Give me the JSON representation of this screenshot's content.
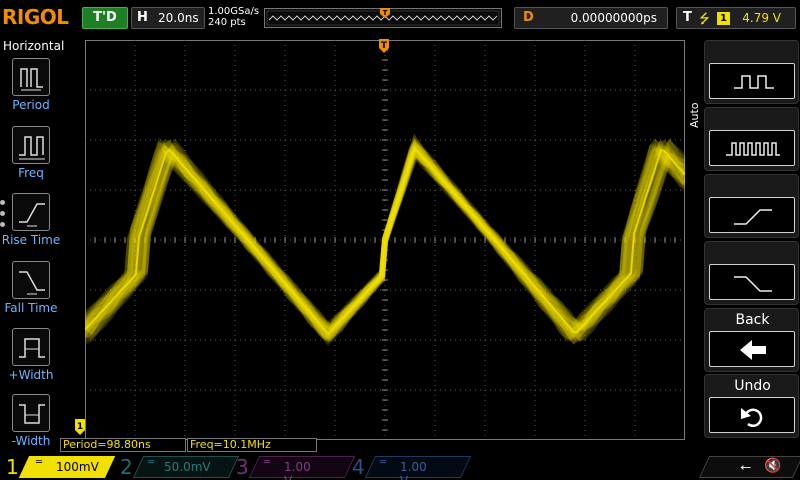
{
  "brand": "RIGOL",
  "run_state": "T'D",
  "horizontal": {
    "key": "H",
    "timebase": "20.0ns"
  },
  "acquisition": {
    "sample_rate": "1.00GSa/s",
    "points": "240 pts"
  },
  "memory_trigger_marker": "T",
  "delay": {
    "key": "D",
    "value": "0.00000000ps"
  },
  "trigger": {
    "key": "T",
    "edge_icon": "rising-edge-icon",
    "source": "1",
    "level": "4.79 V"
  },
  "left_menu": {
    "title": "Horizontal",
    "items": [
      {
        "label": "Period",
        "icon": "period-icon"
      },
      {
        "label": "Freq",
        "icon": "freq-icon"
      },
      {
        "label": "Rise Time",
        "icon": "rise-time-icon"
      },
      {
        "label": "Fall Time",
        "icon": "fall-time-icon"
      },
      {
        "label": "+Width",
        "icon": "positive-width-icon"
      },
      {
        "label": "-Width",
        "icon": "negative-width-icon"
      }
    ]
  },
  "measurements": [
    {
      "text": "Period=98.80ns"
    },
    {
      "text": "Freq=10.1MHz"
    }
  ],
  "right_menu": {
    "mode": "Auto",
    "buttons": [
      {
        "icon": "square-wave-icon"
      },
      {
        "icon": "burst-wave-icon"
      },
      {
        "icon": "rising-edge-icon"
      },
      {
        "icon": "falling-edge-icon"
      },
      {
        "label": "Back",
        "icon": "back-arrow-icon"
      },
      {
        "label": "Undo",
        "icon": "undo-icon"
      }
    ]
  },
  "channels": [
    {
      "num": "1",
      "scale": "100mV",
      "color": "#f2e000",
      "active": true
    },
    {
      "num": "2",
      "scale": "50.0mV",
      "color": "#1f6c6c",
      "active": false
    },
    {
      "num": "3",
      "scale": "1.00 V",
      "color": "#7a2a7a",
      "active": false
    },
    {
      "num": "4",
      "scale": "1.00 V",
      "color": "#2a4f8a",
      "active": false
    }
  ],
  "colors": {
    "accent": "#f28c00",
    "trace": "#f2e000",
    "menu_text": "#6fb4ff",
    "grid": "#5a5a5a"
  }
}
